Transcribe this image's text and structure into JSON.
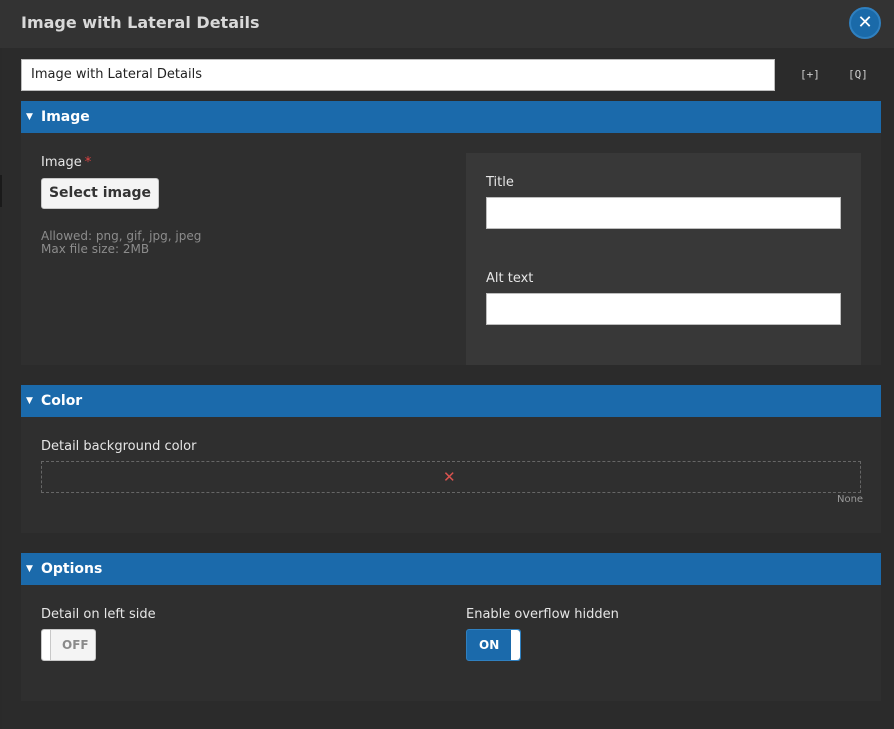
{
  "dialog": {
    "title": "Image with Lateral Details",
    "close_icon": "close-icon"
  },
  "name_field": {
    "value": "Image with Lateral Details"
  },
  "toolbar": {
    "expand_icon": "[+]",
    "preview_icon": "[Q]"
  },
  "sections": {
    "image": {
      "header": "Image",
      "image_label": "Image",
      "required_mark": "*",
      "select_button": "Select image",
      "allowed": "Allowed: png, gif, jpg, jpeg",
      "max_size": "Max file size: 2MB",
      "title_label": "Title",
      "title_value": "",
      "alt_label": "Alt text",
      "alt_value": ""
    },
    "color": {
      "header": "Color",
      "detail_bg_label": "Detail background color",
      "clear_icon": "✕",
      "none_label": "None"
    },
    "options": {
      "header": "Options",
      "left_side_label": "Detail on left side",
      "left_side_state": "OFF",
      "overflow_label": "Enable overflow hidden",
      "overflow_state": "ON"
    }
  },
  "colors": {
    "accent": "#1b6aab",
    "background": "#2b2b2b",
    "required": "#e04343"
  }
}
